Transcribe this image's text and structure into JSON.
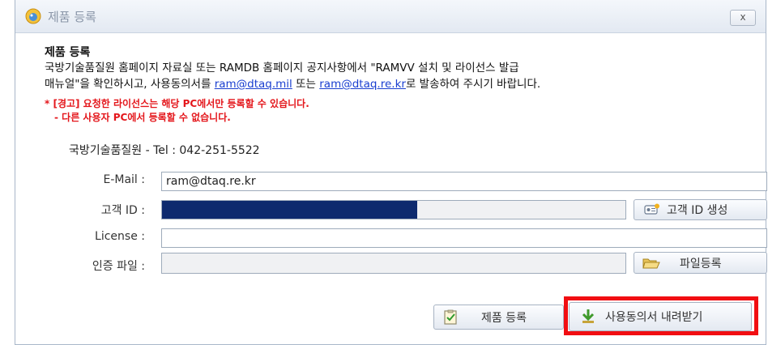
{
  "window": {
    "title": "제품 등록",
    "close_label": "x"
  },
  "info": {
    "heading": "제품 등록",
    "desc_line1": "국방기술품질원 홈페이지 자료실 또는 RAMDB 홈페이지 공지사항에서 \"RAMVV 설치 및 라이선스 발급",
    "desc_line2_a": "매뉴얼\"을 확인하시고, 사용동의서를 ",
    "email_link_1": "ram@dtaq.mil",
    "desc_line2_b": " 또는 ",
    "email_link_2": "ram@dtaq.re.kr",
    "desc_line2_c": "로 발송하여 주시기 바랍니다.",
    "warning_1": "* [경고] 요청한 라이선스는 해당 PC에서만 등록할 수 있습니다.",
    "warning_2": "- 다른 사용자 PC에서 등록할 수 없습니다.",
    "contact": "국방기술품질원 - Tel : 042-251-5522"
  },
  "form": {
    "email_label": "E-Mail :",
    "email_value": "ram@dtaq.re.kr",
    "customer_id_label": "고객 ID :",
    "customer_id_value": "",
    "license_label": "License :",
    "license_value": "",
    "cert_file_label": "인증 파일 :",
    "cert_file_value": ""
  },
  "buttons": {
    "generate_id": "고객 ID 생성",
    "register_file": "파일등록",
    "register_product": "제품 등록",
    "download_agreement": "사용동의서 내려받기"
  },
  "colors": {
    "warning": "#e4161b",
    "link": "#1a3fd0",
    "mask": "#0e2a6e",
    "highlight": "#f10e12"
  },
  "icons": [
    "app-icon",
    "close-icon",
    "id-card-icon",
    "folder-open-icon",
    "checklist-icon",
    "download-icon"
  ]
}
